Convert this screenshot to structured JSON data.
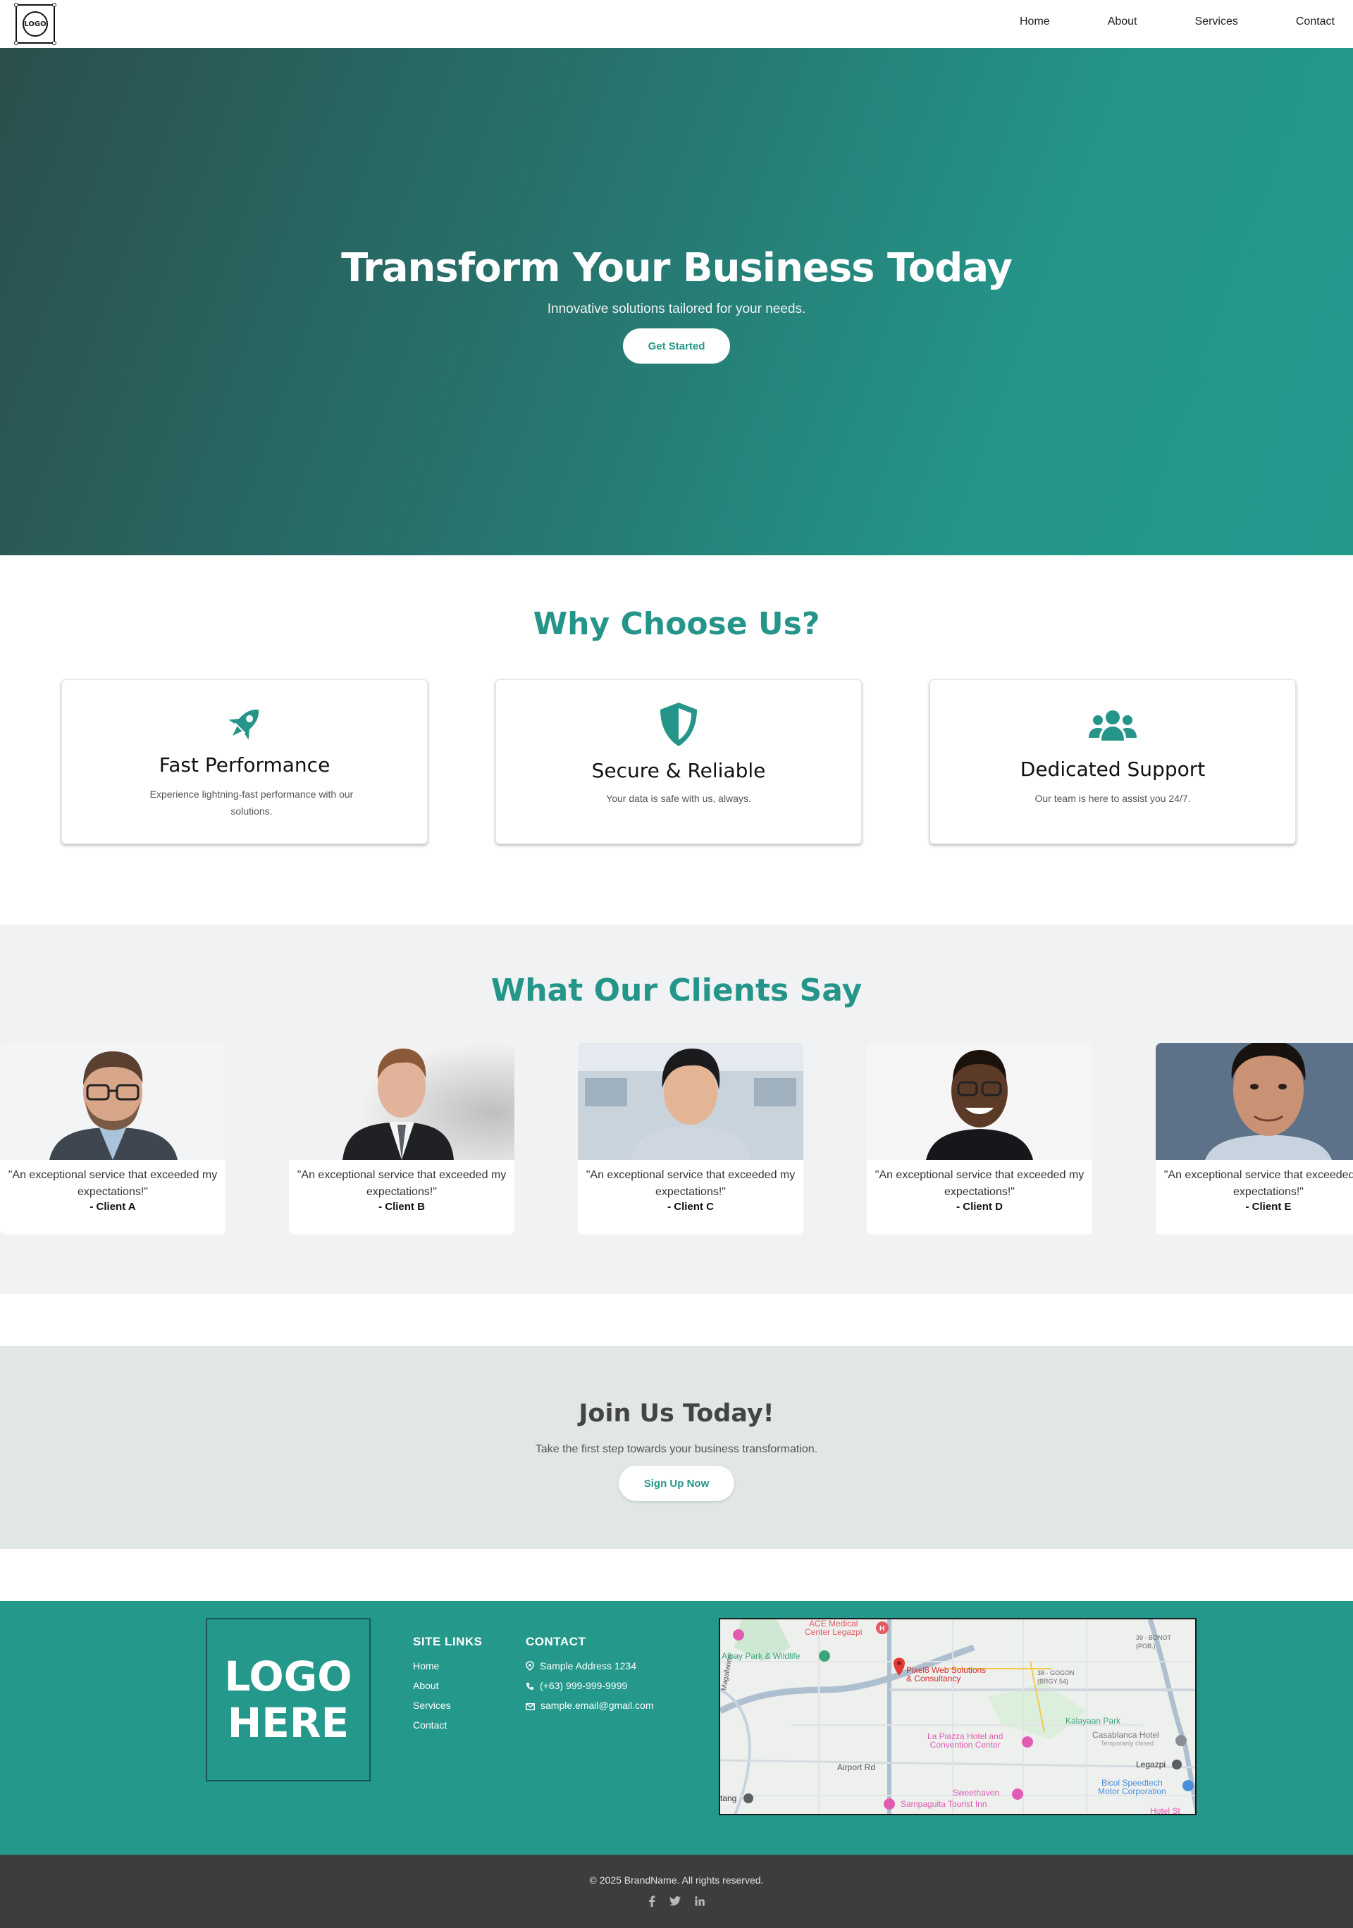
{
  "nav": {
    "logo_text": "LOGO",
    "links": [
      "Home",
      "About",
      "Services",
      "Contact"
    ]
  },
  "hero": {
    "title": "Transform Your Business Today",
    "subtitle": "Innovative solutions tailored for your needs.",
    "cta_label": "Get Started"
  },
  "why": {
    "title": "Why Choose Us?",
    "features": [
      {
        "icon": "rocket-icon",
        "title": "Fast Performance",
        "text": "Experience lightning-fast performance with our solutions."
      },
      {
        "icon": "shield-icon",
        "title": "Secure & Reliable",
        "text": "Your data is safe with us, always."
      },
      {
        "icon": "users-icon",
        "title": "Dedicated Support",
        "text": "Our team is here to assist you 24/7."
      }
    ]
  },
  "testimonials": {
    "title": "What Our Clients Say",
    "items": [
      {
        "quote": "\"An exceptional service that exceeded my expectations!\"",
        "client": "- Client A"
      },
      {
        "quote": "\"An exceptional service that exceeded my expectations!\"",
        "client": "- Client B"
      },
      {
        "quote": "\"An exceptional service that exceeded my expectations!\"",
        "client": "- Client C"
      },
      {
        "quote": "\"An exceptional service that exceeded my expectations!\"",
        "client": "- Client D"
      },
      {
        "quote": "\"An exceptional service that exceeded my expectations!\"",
        "client": "- Client E"
      }
    ]
  },
  "cta": {
    "title": "Join Us Today!",
    "text": "Take the first step towards your business transformation.",
    "button": "Sign Up Now"
  },
  "footer": {
    "logo_line1": "LOGO",
    "logo_line2": "HERE",
    "site_links_title": "SITE LINKS",
    "site_links": [
      "Home",
      "About",
      "Services",
      "Contact"
    ],
    "contact_title": "CONTACT",
    "address": "Sample Address 1234",
    "phone": "(+63) 999-999-9999",
    "email": "sample.email@gmail.com",
    "map_labels": {
      "ace": "ACE Medical\nCenter Legazpi",
      "albay": "Albay Park & Wildlife",
      "pixel8": "Pixel8 Web Solutions\n& Consultancy",
      "brgy39": "39 - BONOT\n(POB.)",
      "brgy38": "38 - GOGON\n(BRGY 54)",
      "kalayaan": "Kalayaan Park",
      "casablanca": "Casablanca Hotel",
      "closed": "Temporarily closed",
      "lapiazza": "La Piazza Hotel and\nConvention Center",
      "legazpi": "Legazpi",
      "airport": "Airport Rd",
      "bicol": "Bicol Speedtech\nMotor Corporation",
      "sweethaven": "Sweethaven",
      "sampaguita": "Sampaguita Tourist Inn",
      "hotelst": "Hotel St",
      "tang": "tang",
      "roadside": "Magallanes"
    },
    "copyright": "© 2025 BrandName. All rights reserved.",
    "social": [
      "facebook-icon",
      "twitter-icon",
      "linkedin-icon"
    ]
  },
  "colors": {
    "accent": "#25958a",
    "footer_bg": "#24988a",
    "bottom_bg": "#3d3d3d",
    "cta_bg": "#e0e7e6",
    "clients_bg": "#f1f2f4"
  }
}
